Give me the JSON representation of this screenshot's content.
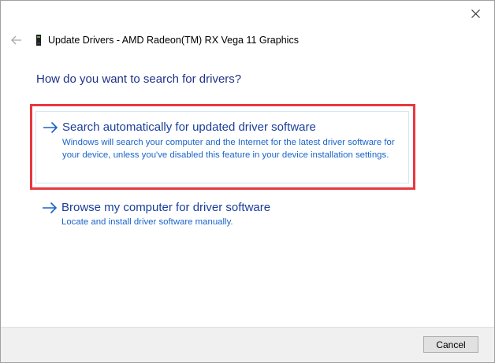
{
  "window": {
    "title": "Update Drivers - AMD Radeon(TM) RX Vega 11 Graphics",
    "close_icon": "close-icon",
    "back_icon": "back-arrow-icon",
    "device_icon": "graphics-card-icon"
  },
  "main": {
    "question": "How do you want to search for drivers?",
    "options": [
      {
        "title": "Search automatically for updated driver software",
        "description": "Windows will search your computer and the Internet for the latest driver software for your device, unless you've disabled this feature in your device installation settings.",
        "icon": "right-arrow-icon",
        "highlighted": true
      },
      {
        "title": "Browse my computer for driver software",
        "description": "Locate and install driver software manually.",
        "icon": "right-arrow-icon",
        "highlighted": false
      }
    ]
  },
  "footer": {
    "cancel_label": "Cancel"
  },
  "colors": {
    "heading": "#1e3287",
    "option_title": "#1a3e9a",
    "option_description": "#1a64c8",
    "highlight_border": "#e8383f",
    "footer_background": "#f0f0f0"
  }
}
